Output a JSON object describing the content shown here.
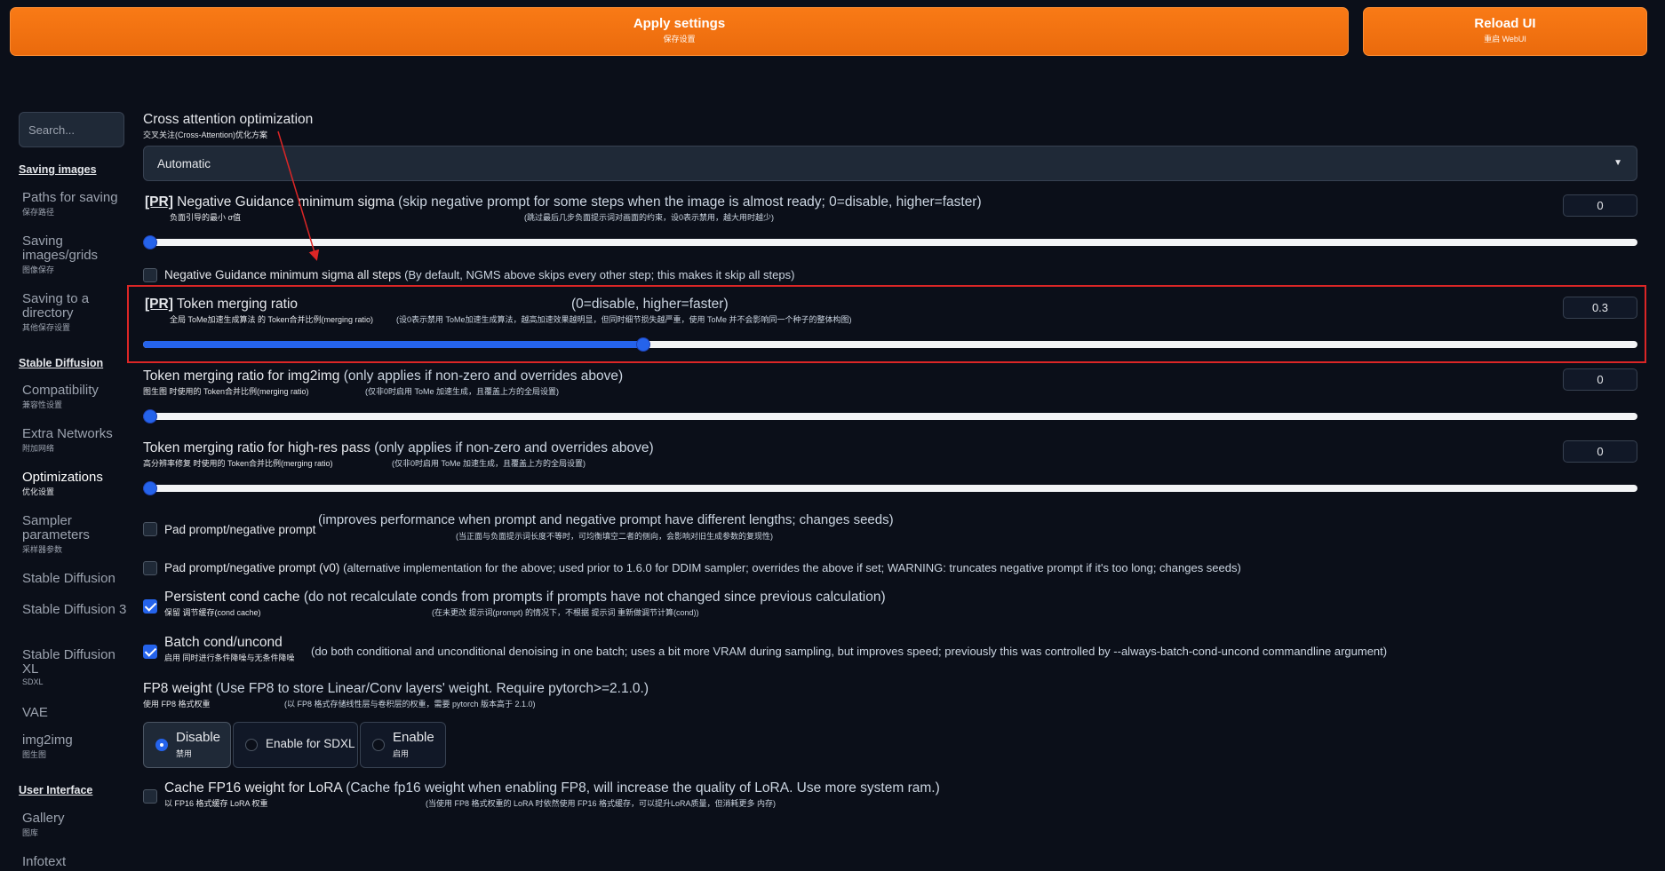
{
  "header": {
    "apply_label": "Apply settings",
    "apply_sub": "保存设置",
    "reload_label": "Reload UI",
    "reload_sub": "重启 WebUI"
  },
  "sidebar": {
    "search_placeholder": "Search...",
    "sections": [
      {
        "label": "Saving images"
      },
      {
        "label": "Stable Diffusion"
      },
      {
        "label": "User Interface"
      }
    ],
    "items": [
      {
        "label": "Paths for saving",
        "zh": "保存路径"
      },
      {
        "label": "Saving images/grids",
        "zh": "图像保存"
      },
      {
        "label": "Saving to a directory",
        "zh": "其他保存设置"
      },
      {
        "label": "Compatibility",
        "zh": "兼容性设置"
      },
      {
        "label": "Extra Networks",
        "zh": "附加网络"
      },
      {
        "label": "Optimizations",
        "zh": "优化设置"
      },
      {
        "label": "Sampler parameters",
        "zh": "采样器参数"
      },
      {
        "label": "Stable Diffusion",
        "zh": ""
      },
      {
        "label": "Stable Diffusion 3",
        "zh": ""
      },
      {
        "label": "Stable Diffusion XL",
        "zh": "SDXL"
      },
      {
        "label": "VAE",
        "zh": ""
      },
      {
        "label": "img2img",
        "zh": "图生图"
      },
      {
        "label": "Gallery",
        "zh": "图库"
      },
      {
        "label": "Infotext",
        "zh": ""
      }
    ]
  },
  "settings": {
    "cross_attention": {
      "title": "Cross attention optimization",
      "zh": "交叉关注(Cross-Attention)优化方案",
      "value": "Automatic"
    },
    "ngms": {
      "pr": "[PR]",
      "title": "Negative Guidance minimum sigma",
      "desc": "(skip negative prompt for some steps when the image is almost ready; 0=disable, higher=faster)",
      "zh": "负面引导的最小 σ值",
      "zh_desc": "(跳过最后几步负面提示词对画面的约束，设0表示禁用，越大用时越少)",
      "value": "0",
      "fraction": 0
    },
    "ngms_all": {
      "title": "Negative Guidance minimum sigma all steps",
      "desc": "(By default, NGMS above skips every other step; this makes it skip all steps)",
      "checked": false
    },
    "token_merging": {
      "pr": "[PR]",
      "title": "Token merging ratio",
      "desc": "(0=disable, higher=faster)",
      "zh": "全局 ToMe加速生成算法 的 Token合并比例(merging ratio)",
      "zh_desc": "(设0表示禁用 ToMe加速生成算法，越高加速效果越明显，但同时细节损失越严重，使用 ToMe 并不会影响同一个种子的整体构图)",
      "value": "0.3",
      "fraction": 0.335
    },
    "token_merging_img2img": {
      "title": "Token merging ratio for img2img",
      "desc": "(only applies if non-zero and overrides above)",
      "zh": "图生图 时使用的 Token合并比例(merging ratio)",
      "zh_desc": "(仅非0时启用 ToMe 加速生成，且覆盖上方的全局设置)",
      "value": "0",
      "fraction": 0
    },
    "token_merging_hr": {
      "title": "Token merging ratio for high-res pass",
      "desc": "(only applies if non-zero and overrides above)",
      "zh": "高分辨率修复 时使用的 Token合并比例(merging ratio)",
      "zh_desc": "(仅非0时启用 ToMe 加速生成，且覆盖上方的全局设置)",
      "value": "0",
      "fraction": 0
    },
    "pad_prompt": {
      "title": "Pad prompt/negative prompt",
      "desc": "(improves performance when prompt and negative prompt have different lengths; changes seeds)",
      "zh_desc": "(当正面与负面提示词长度不等时，可均衡填空二者的侧向，会影响对旧生成参数的复现性)",
      "checked": false
    },
    "pad_prompt_v0": {
      "title": "Pad prompt/negative prompt (v0)",
      "desc": "(alternative implementation for the above; used prior to 1.6.0 for DDIM sampler; overrides the above if set; WARNING: truncates negative prompt if it's too long; changes seeds)",
      "checked": false
    },
    "persistent_cond": {
      "title": "Persistent cond cache",
      "desc": "(do not recalculate conds from prompts if prompts have not changed since previous calculation)",
      "zh": "保留 调节缓存(cond cache)",
      "zh_desc": "(在未更改 提示词(prompt) 的情况下，不根据 提示词 重新做调节计算(cond))",
      "checked": true
    },
    "batch_cond": {
      "title": "Batch cond/uncond",
      "desc": "(do both conditional and unconditional denoising in one batch; uses a bit more VRAM during sampling, but improves speed; previously this was controlled by --always-batch-cond-uncond commandline argument)",
      "zh": "启用 同时进行条件降噪与无条件降噪",
      "checked": true
    },
    "fp8": {
      "title": "FP8 weight",
      "desc": "(Use FP8 to store Linear/Conv layers' weight. Require pytorch>=2.1.0.)",
      "zh": "使用 FP8 格式权重",
      "zh_desc": "(以 FP8 格式存储线性层与卷积层的权重，需要 pytorch 版本高于 2.1.0)",
      "options": [
        {
          "label": "Disable",
          "zh": "禁用",
          "selected": true
        },
        {
          "label": "Enable for SDXL",
          "zh": "",
          "selected": false
        },
        {
          "label": "Enable",
          "zh": "启用",
          "selected": false
        }
      ]
    },
    "cache_fp16": {
      "title": "Cache FP16 weight for LoRA",
      "desc": "(Cache fp16 weight when enabling FP8, will increase the quality of LoRA. Use more system ram.)",
      "zh": "以 FP16 格式缓存 LoRA 权重",
      "zh_desc": "(当使用 FP8 格式权重的 LoRA 时依然使用 FP16 格式缓存，可以提升LoRA质量，但消耗更多 内存)",
      "checked": false
    }
  },
  "colors": {
    "accent": "#2563eb",
    "brand_orange": "#f97316",
    "highlight": "#dc2626",
    "background": "#0b0f19"
  }
}
